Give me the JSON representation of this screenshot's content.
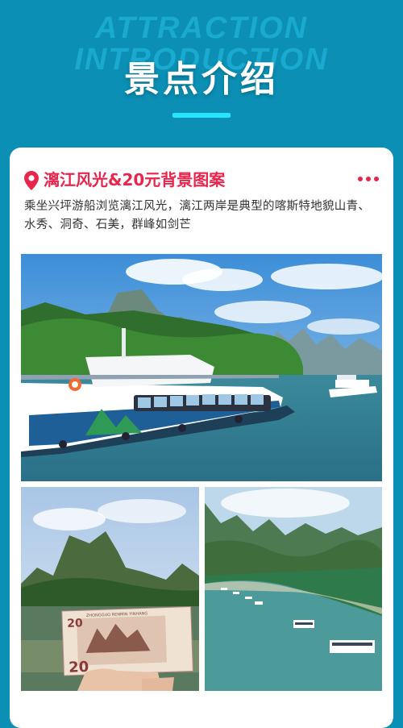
{
  "header": {
    "bg_line1": "ATTRACTION",
    "bg_line2": "INTRODUCTION",
    "title": "景点介绍"
  },
  "card": {
    "title": "漓江风光&20元背景图案",
    "description": "乘坐兴坪游船浏览漓江风光，漓江两岸是典型的喀斯特地貌山青、水秀、洞奇、石美，群峰如剑芒"
  },
  "photos": {
    "banknote_value": "20",
    "banknote_text": "ZHONGGUO RENMIN YINHANG"
  },
  "colors": {
    "background": "#0b8fb4",
    "accent": "#e8264d",
    "underline": "#28e4ff"
  }
}
